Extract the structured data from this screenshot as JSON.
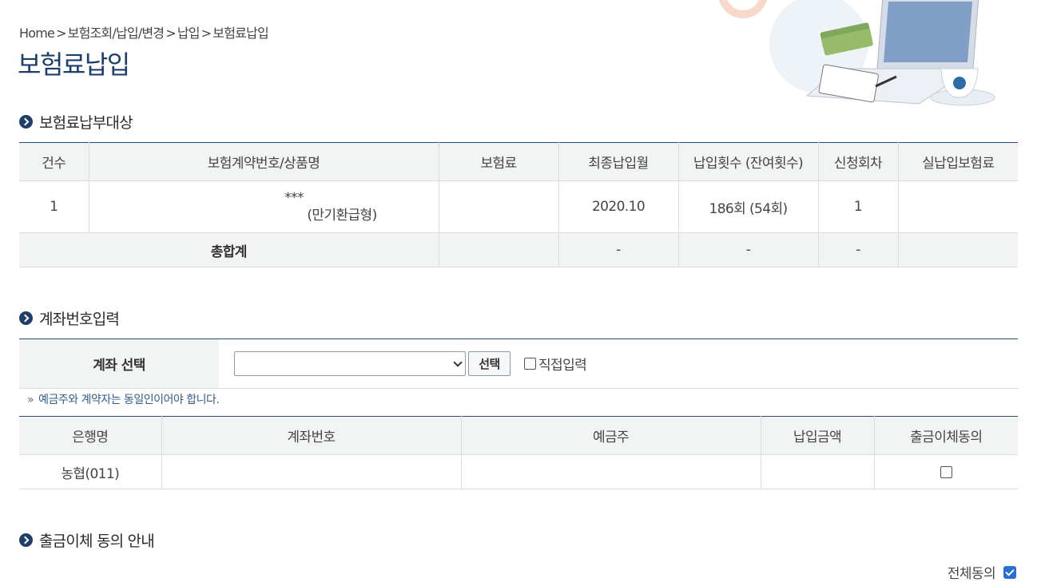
{
  "breadcrumb": [
    "Home",
    "보험조회/납입/변경",
    "납입",
    "보험료납입"
  ],
  "breadcrumb_sep": ">",
  "page_title": "보험료납입",
  "sections": {
    "target": "보험료납부대상",
    "account": "계좌번호입력",
    "withdraw_notice": "출금이체 동의 안내"
  },
  "target_table": {
    "headers": [
      "건수",
      "보험계약번호/상품명",
      "보험료",
      "최종납입월",
      "납입횟수 (잔여횟수)",
      "신청회차",
      "실납입보험료"
    ],
    "rows": [
      {
        "count": "1",
        "contract_no": "***",
        "product": "(만기환급형)",
        "premium": "",
        "last_month": "2020.10",
        "times": "186회 (54회)",
        "apply": "1",
        "actual": ""
      }
    ],
    "total": {
      "label": "총합계",
      "premium": "",
      "last_month": "-",
      "times": "-",
      "apply": "-",
      "actual": ""
    }
  },
  "account_select": {
    "label": "계좌 선택",
    "select_value": "",
    "button": "선택",
    "direct_label": "직접입력"
  },
  "notice": {
    "mark": "»",
    "text": "예금주와 계약자는 동일인이어야 합니다."
  },
  "account_table": {
    "headers": [
      "은행명",
      "계좌번호",
      "예금주",
      "납입금액",
      "출금이체동의"
    ],
    "rows": [
      {
        "bank": "농협(011)",
        "account_no": "",
        "holder": "",
        "amount": "",
        "agree": false
      }
    ]
  },
  "agree_all": {
    "label": "전체동의",
    "checked": true
  },
  "colors": {
    "navy": "#1e3e6e",
    "header_bg": "#f2f4f4",
    "notice": "#2f5c8a",
    "check": "#2a6fd4"
  }
}
